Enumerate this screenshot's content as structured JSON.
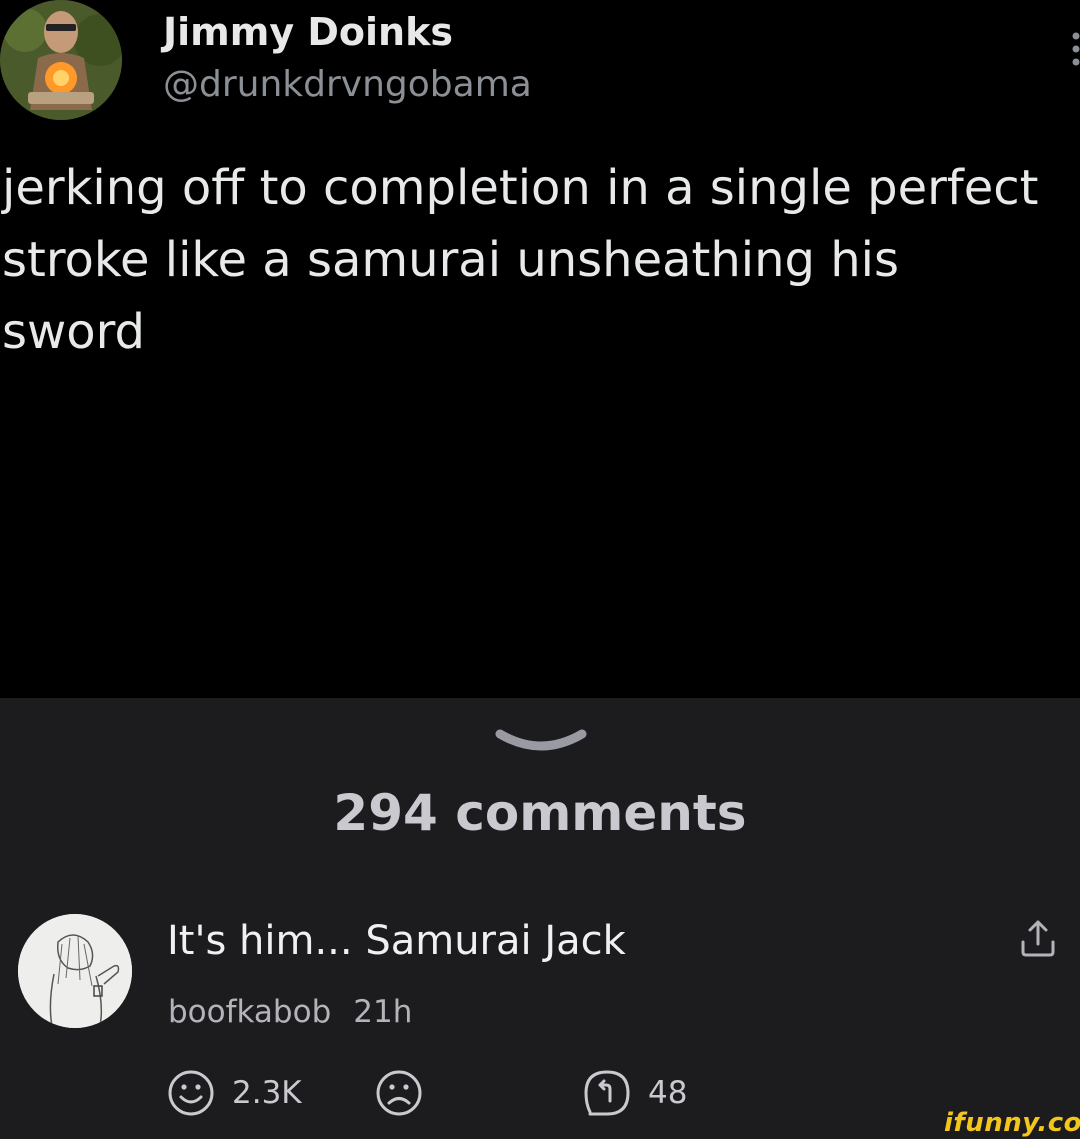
{
  "tweet": {
    "author_name": "Jimmy Doinks",
    "author_handle": "@drunkdrvngobama",
    "text": "jerking off to completion in a single perfect\nstroke like a samurai unsheathing his\nsword"
  },
  "comments": {
    "count_label": "294 comments",
    "items": [
      {
        "text": "It's him... Samurai Jack",
        "username": "boofkabob",
        "time": "21h",
        "smile_count": "2.3K",
        "reply_count": "48"
      }
    ]
  },
  "icons": {
    "more": "more-vertical-icon",
    "collapse": "chevron-down-icon",
    "share": "share-icon",
    "smile": "smile-icon",
    "frown": "frown-icon",
    "reply": "reply-icon"
  },
  "colors": {
    "tweet_bg": "#000000",
    "comments_bg": "#1c1c1f",
    "watermark": "#f4c51b"
  },
  "watermark": "ifunny.co"
}
